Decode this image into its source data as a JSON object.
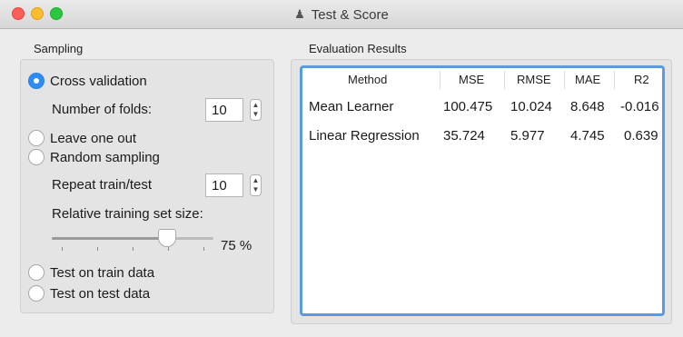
{
  "window": {
    "title": "Test & Score",
    "icon": "orange-widget-icon"
  },
  "sampling": {
    "group_label": "Sampling",
    "options": [
      {
        "label": "Cross validation",
        "checked": true
      },
      {
        "label": "Leave one out",
        "checked": false
      },
      {
        "label": "Random sampling",
        "checked": false
      },
      {
        "label": "Test on train data",
        "checked": false
      },
      {
        "label": "Test on test data",
        "checked": false
      }
    ],
    "folds": {
      "label": "Number of folds:",
      "value": "10"
    },
    "repeat": {
      "label": "Repeat train/test",
      "value": "10"
    },
    "training_size": {
      "label": "Relative training set size:",
      "value_label": "75 %",
      "value": 75
    }
  },
  "results": {
    "group_label": "Evaluation Results",
    "columns": [
      "Method",
      "MSE",
      "RMSE",
      "MAE",
      "R2"
    ],
    "rows": [
      [
        "Mean Learner",
        "100.475",
        "10.024",
        "8.648",
        "-0.016"
      ],
      [
        "Linear Regression",
        "35.724",
        "5.977",
        "4.745",
        "0.639"
      ]
    ]
  }
}
